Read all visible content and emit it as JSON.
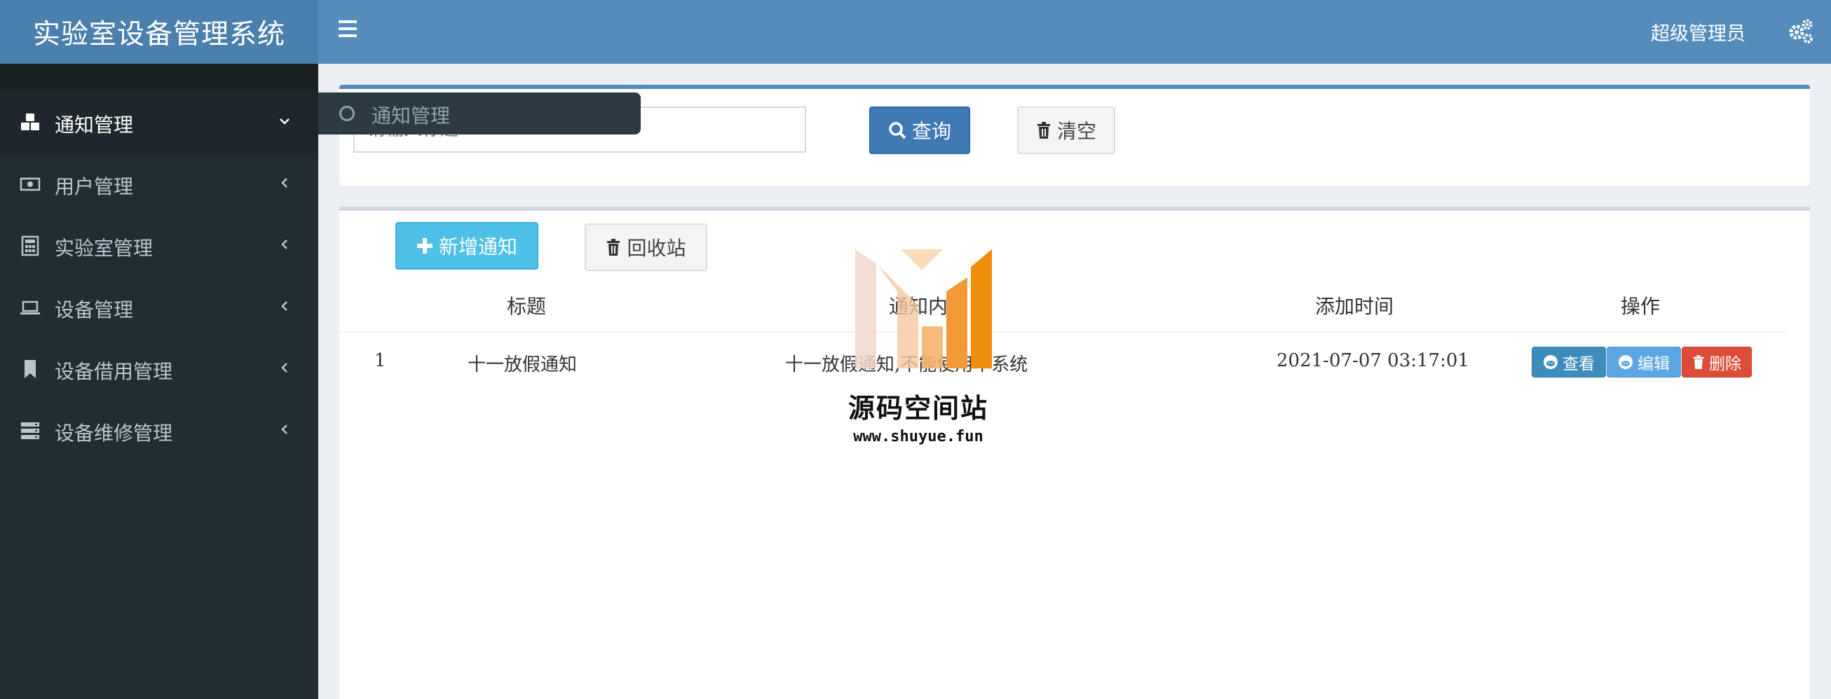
{
  "app": {
    "title": "实验室设备管理系统"
  },
  "header": {
    "user_name": "超级管理员",
    "menu_icon": "hamburger-icon",
    "settings_icon": "gears-icon"
  },
  "sidebar": {
    "items": [
      {
        "label": "通知管理",
        "icon": "cubes-icon",
        "expanded": true
      },
      {
        "label": "用户管理",
        "icon": "money-icon",
        "expanded": false
      },
      {
        "label": "实验室管理",
        "icon": "calculator-icon",
        "expanded": false
      },
      {
        "label": "设备管理",
        "icon": "laptop-icon",
        "expanded": false
      },
      {
        "label": "设备借用管理",
        "icon": "bookmark-icon",
        "expanded": false
      },
      {
        "label": "设备维修管理",
        "icon": "server-icon",
        "expanded": false
      }
    ],
    "flyout": {
      "label": "通知管理"
    }
  },
  "search": {
    "placeholder": "请输入标题",
    "query_label": "查询",
    "clear_label": "清空"
  },
  "toolbar": {
    "add_label": "新增通知",
    "recycle_label": "回收站"
  },
  "table": {
    "columns": [
      "标题",
      "通知内容",
      "添加时间",
      "操作"
    ],
    "rows": [
      {
        "index": "1",
        "title": "十一放假通知",
        "content": "十一放假通知,不能使用本系统",
        "time": "2021-07-07 03:17:01"
      }
    ],
    "actions": {
      "view": "查看",
      "edit": "编辑",
      "delete": "删除"
    }
  },
  "watermark": {
    "title": "源码空间站",
    "url": "www.shuyue.fun"
  },
  "colors": {
    "header": "#548cbc",
    "logo_bg": "#4b7fad",
    "sidebar": "#222d32",
    "primary": "#3c8dbc",
    "info": "#4ec0e8",
    "danger": "#dd4b39"
  }
}
